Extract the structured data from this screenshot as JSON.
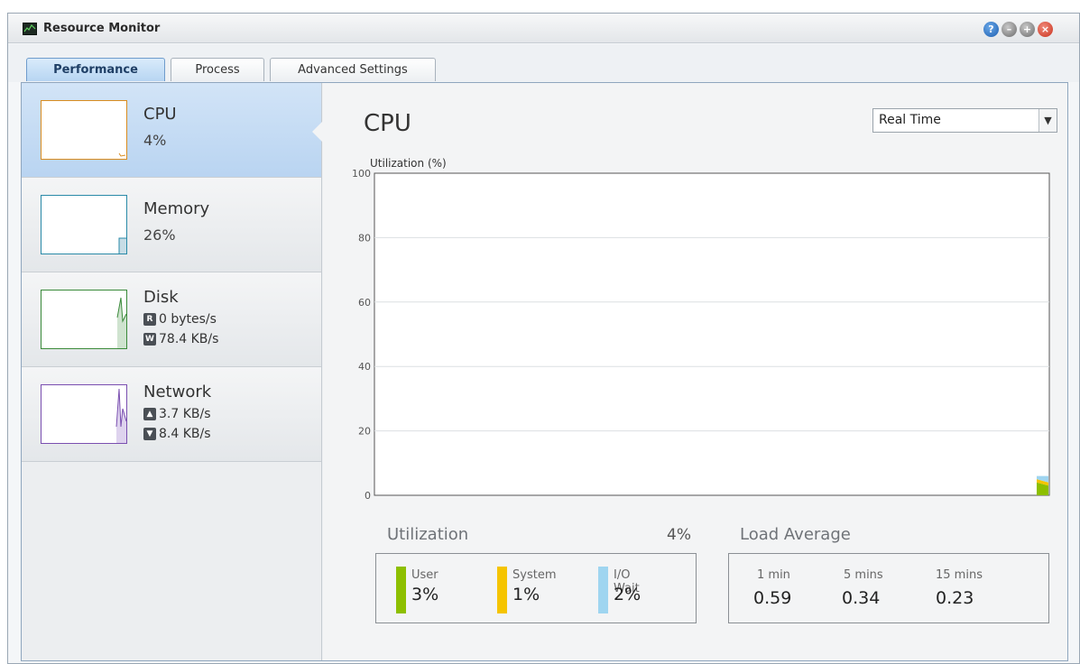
{
  "window": {
    "title": "Resource Monitor"
  },
  "tabs": [
    {
      "label": "Performance",
      "active": true
    },
    {
      "label": "Process",
      "active": false
    },
    {
      "label": "Advanced Settings",
      "active": false
    }
  ],
  "sidebar": {
    "cpu": {
      "name": "CPU",
      "value": "4%",
      "color": "#d98c1f"
    },
    "memory": {
      "name": "Memory",
      "value": "26%",
      "color": "#2a8aa8"
    },
    "disk": {
      "name": "Disk",
      "read_badge": "R",
      "read": "0 bytes/s",
      "write_badge": "W",
      "write": "78.4 KB/s",
      "color": "#3a8a3a"
    },
    "network": {
      "name": "Network",
      "upload": "3.7 KB/s",
      "download": "8.4 KB/s",
      "color": "#7a4fb0"
    }
  },
  "main": {
    "title": "CPU",
    "range_select": {
      "value": "Real Time"
    },
    "chart_label": "Utilization (%)"
  },
  "chart_data": {
    "type": "area",
    "ylabel": "Utilization (%)",
    "ylim": [
      0,
      100
    ],
    "yticks": [
      0,
      20,
      40,
      60,
      80,
      100
    ],
    "grid": true,
    "series": [
      {
        "name": "User",
        "color": "#8dbf00",
        "values": [
          4,
          3
        ]
      },
      {
        "name": "System",
        "color": "#f5c400",
        "values": [
          1,
          1
        ]
      },
      {
        "name": "I/O Wait",
        "color": "#9fd5f0",
        "values": [
          1,
          2
        ]
      }
    ]
  },
  "utilization": {
    "title": "Utilization",
    "total": "4%",
    "items": [
      {
        "label": "User",
        "value": "3%",
        "color": "#8dbf00"
      },
      {
        "label": "System",
        "value": "1%",
        "color": "#f5c400"
      },
      {
        "label": "I/O Wait",
        "value": "2%",
        "color": "#9fd5f0"
      }
    ]
  },
  "load_average": {
    "title": "Load Average",
    "items": [
      {
        "label": "1 min",
        "value": "0.59"
      },
      {
        "label": "5 mins",
        "value": "0.34"
      },
      {
        "label": "15 mins",
        "value": "0.23"
      }
    ]
  }
}
